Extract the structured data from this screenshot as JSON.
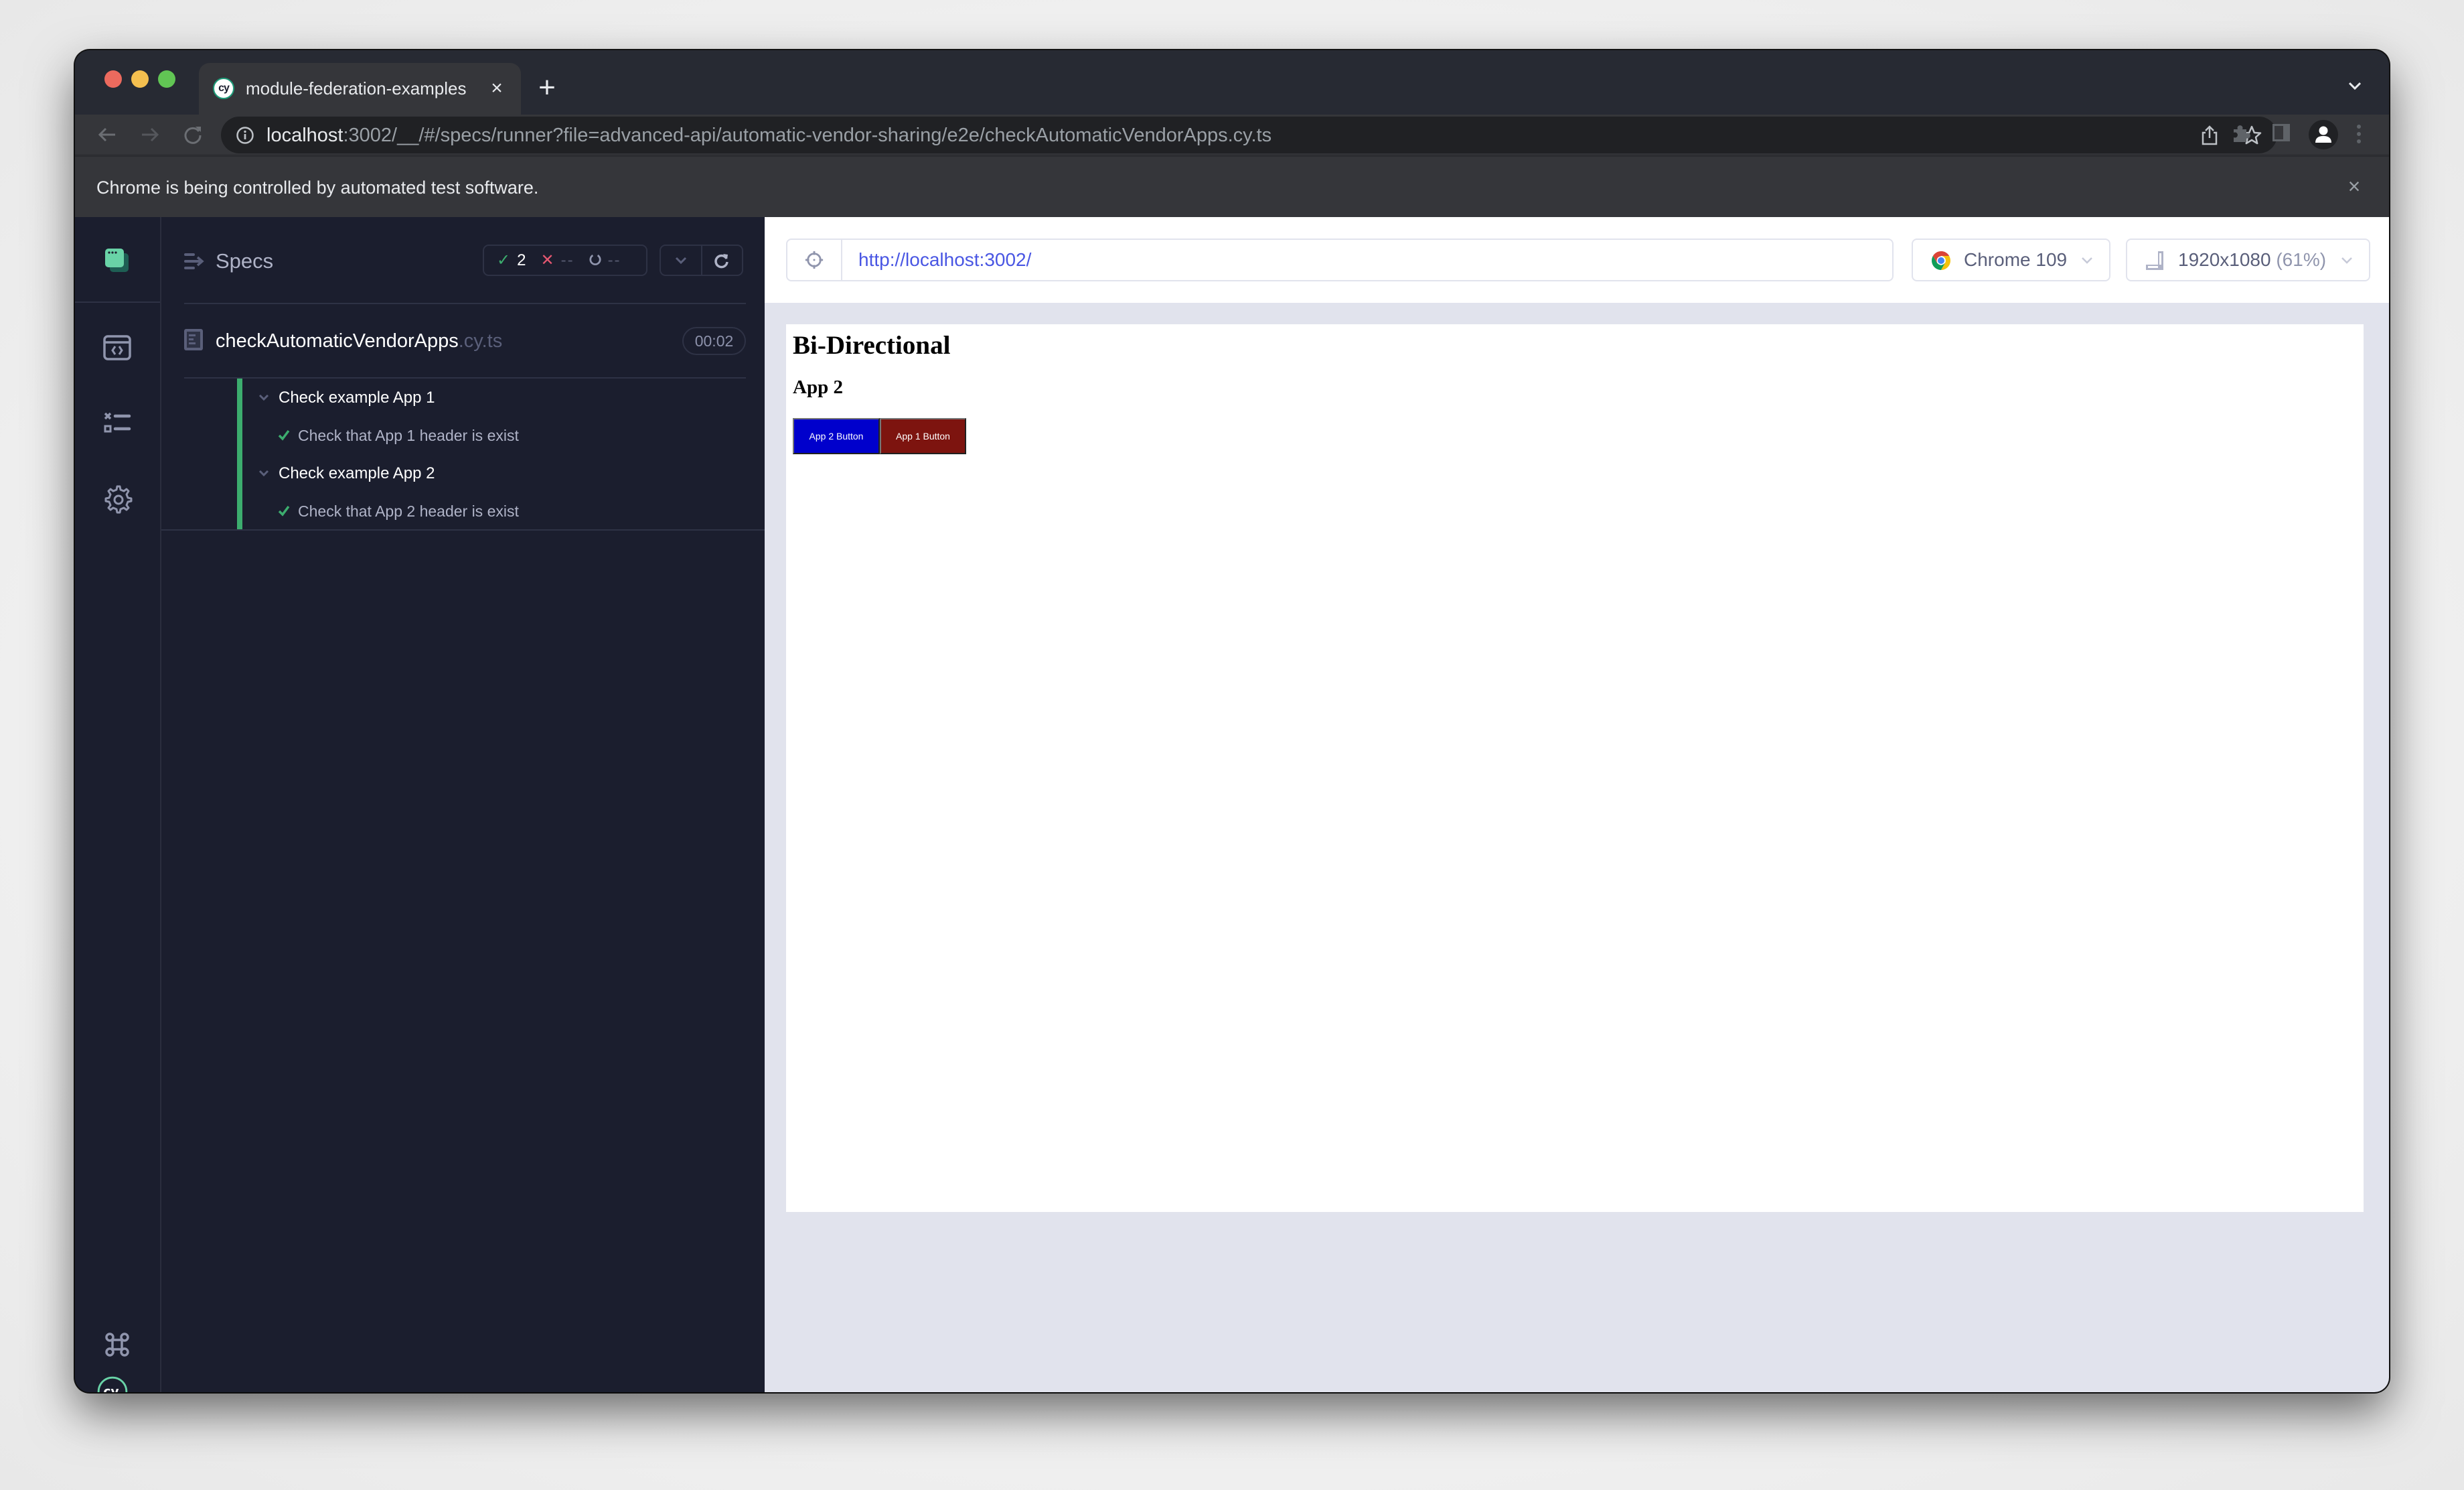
{
  "browser": {
    "tab": {
      "title": "module-federation-examples",
      "favicon": "cypress-favicon-icon"
    },
    "omnibox": {
      "host": "localhost",
      "rest": ":3002/__/#/specs/runner?file=advanced-api/automatic-vendor-sharing/e2e/checkAutomaticVendorApps.cy.ts"
    },
    "infobar": {
      "message": "Chrome is being controlled by automated test software."
    }
  },
  "sidebar": {
    "items": [
      {
        "name": "specs-nav-icon"
      },
      {
        "name": "runs-nav-icon"
      },
      {
        "name": "debug-nav-icon"
      },
      {
        "name": "settings-nav-icon"
      }
    ],
    "bottom": [
      {
        "name": "keyboard-shortcuts-icon",
        "glyph": "⌘"
      },
      {
        "name": "cypress-logo",
        "text": "cy"
      }
    ]
  },
  "reporter": {
    "header": {
      "title": "Specs",
      "stats": {
        "passed": "2",
        "failed": "--",
        "pending": "--"
      }
    },
    "spec": {
      "name": "checkAutomaticVendorApps",
      "extension": ".cy.ts",
      "duration": "00:02"
    },
    "runnables": [
      {
        "type": "suite",
        "title": "Check example App 1",
        "tests": [
          {
            "title": "Check that App 1 header is exist",
            "state": "passed"
          }
        ]
      },
      {
        "type": "suite",
        "title": "Check example App 2",
        "tests": [
          {
            "title": "Check that App 2 header is exist",
            "state": "passed"
          }
        ]
      }
    ]
  },
  "aut": {
    "url": "http://localhost:3002/",
    "browser": "Chrome 109",
    "viewport": "1920x1080",
    "scale": "(61%)",
    "page": {
      "heading": "Bi-Directional",
      "subheading": "App 2",
      "buttons": [
        {
          "label": "App 2 Button",
          "color": "#0000cc"
        },
        {
          "label": "App 1 Button",
          "color": "#7d140f"
        }
      ]
    }
  },
  "colors": {
    "pass": "#3cad6e",
    "fail": "#e45770",
    "url_link": "#4956e3",
    "reporter_bg": "#1b1e2e"
  }
}
